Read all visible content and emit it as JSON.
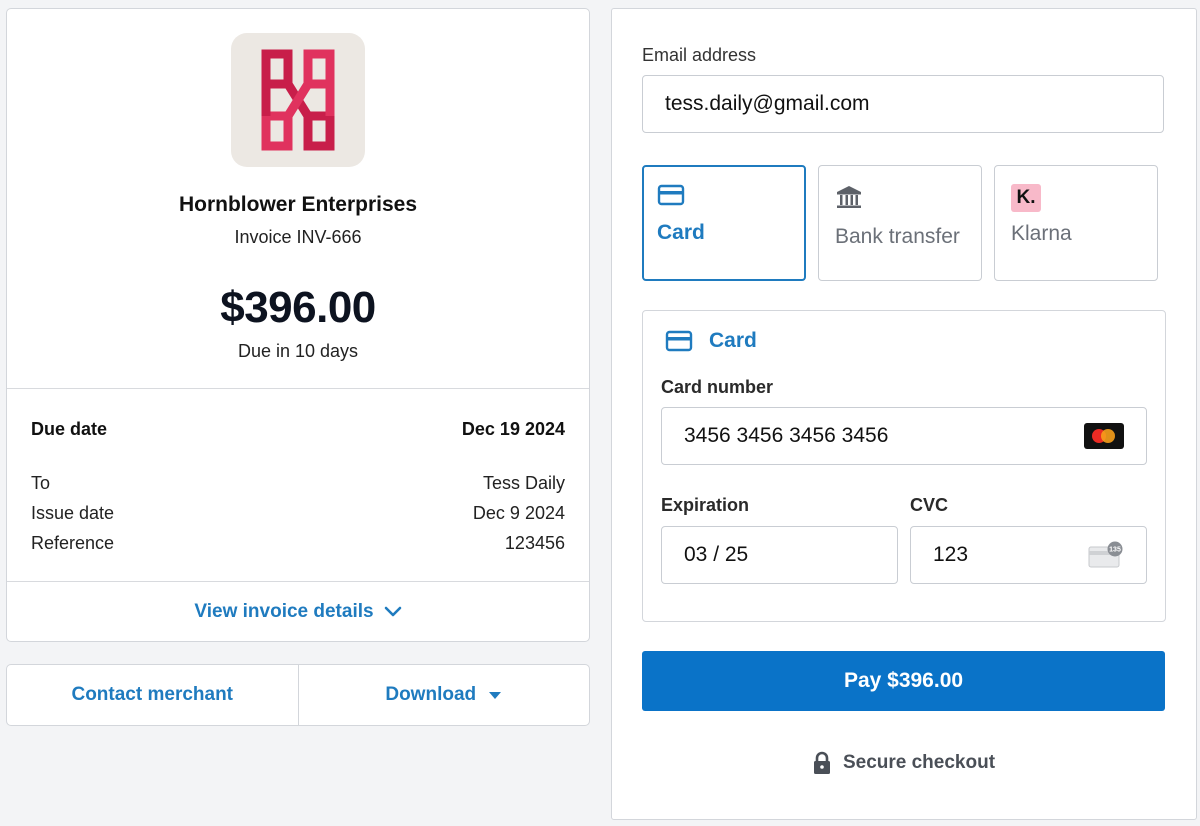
{
  "invoice": {
    "merchant_name": "Hornblower Enterprises",
    "invoice_number": "Invoice INV-666",
    "amount": "$396.00",
    "due_in": "Due in 10 days",
    "details": [
      {
        "label": "Due date",
        "value": "Dec 19 2024"
      },
      {
        "label": "To",
        "value": "Tess Daily"
      },
      {
        "label": "Issue date",
        "value": "Dec 9 2024"
      },
      {
        "label": "Reference",
        "value": "123456"
      }
    ],
    "view_details_label": "View invoice details",
    "logo_icon": "hornblower-logo",
    "logo_colors": [
      "#c81e4a",
      "#e0325e"
    ]
  },
  "actions": {
    "contact_label": "Contact merchant",
    "download_label": "Download"
  },
  "payment": {
    "email_label": "Email address",
    "email_value": "tess.daily@gmail.com",
    "methods": [
      {
        "label": "Card",
        "icon": "credit-card-icon",
        "selected": true
      },
      {
        "label": "Bank transfer",
        "icon": "bank-icon",
        "selected": false
      },
      {
        "label": "Klarna",
        "icon": "klarna-icon",
        "badge": "K.",
        "selected": false
      }
    ],
    "card_section_title": "Card",
    "card_number_label": "Card number",
    "card_number_value": "3456 3456 3456 3456",
    "card_brand_icon": "mastercard-icon",
    "expiration_label": "Expiration",
    "expiration_value": "03 / 25",
    "cvc_label": "CVC",
    "cvc_value": "123",
    "cvc_badge": "135",
    "pay_button_label": "Pay $396.00",
    "secure_label": "Secure checkout"
  },
  "colors": {
    "accent": "#1f7bbf",
    "pay_button": "#0a73c8",
    "klarna_pink": "#f8b9c9"
  }
}
